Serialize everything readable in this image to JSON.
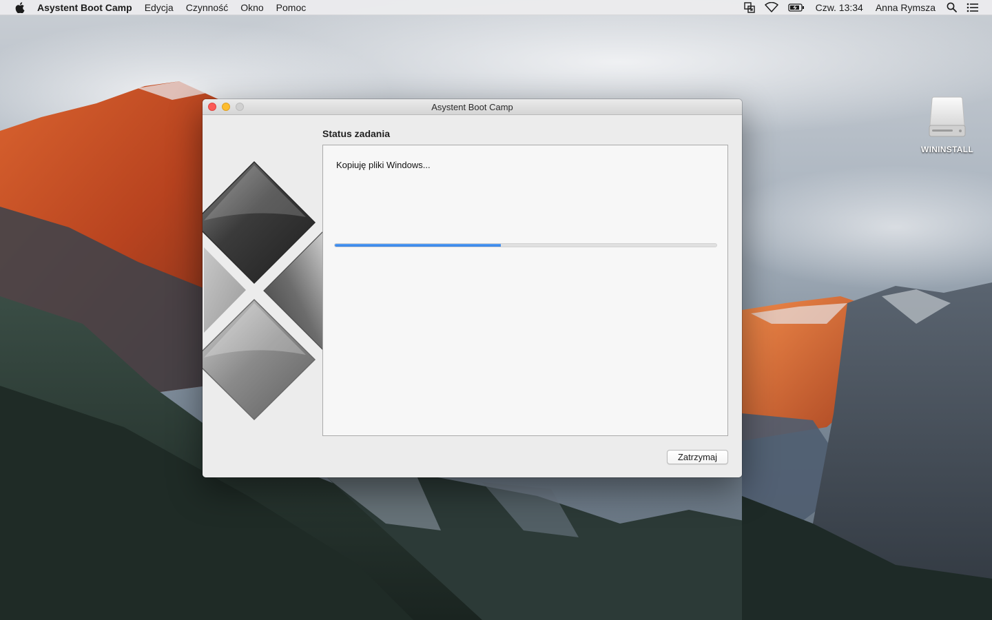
{
  "menubar": {
    "app_name": "Asystent Boot Camp",
    "menus": [
      "Edycja",
      "Czynność",
      "Okno",
      "Pomoc"
    ],
    "clock": "Czw. 13:34",
    "user": "Anna Rymsza",
    "status_icons": [
      "apple-icon",
      "display-mirroring-icon",
      "wifi-icon",
      "battery-charging-icon",
      "spotlight-search-icon",
      "notification-center-icon"
    ]
  },
  "desktop": {
    "drive_label": "WININSTALL"
  },
  "window": {
    "title": "Asystent Boot Camp",
    "section_title": "Status zadania",
    "status_message": "Kopiuję pliki Windows...",
    "progress_fraction": 0.435,
    "stop_button": "Zatrzymaj",
    "accent_color": "#2f7fe8"
  }
}
